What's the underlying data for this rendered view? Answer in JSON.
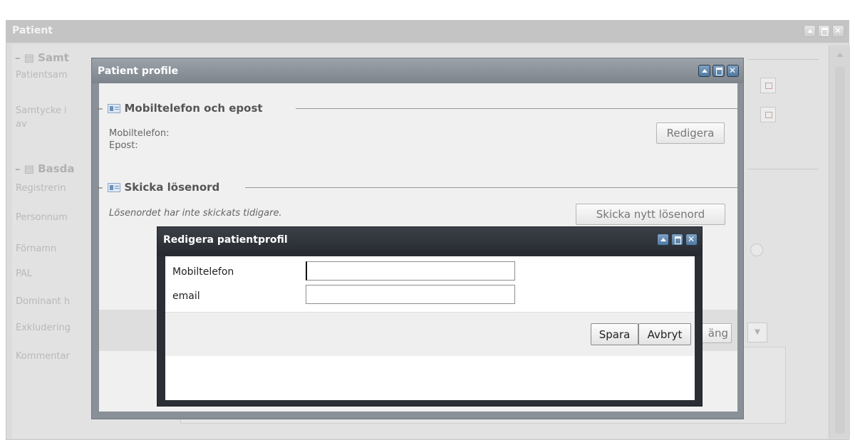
{
  "background_window": {
    "title": "Patient",
    "section1_legend": "Samt",
    "section2_legend": "Basda",
    "labels": [
      "Patientsam",
      "Samtycke i",
      "av",
      "Registrerin",
      "Personnum",
      "Förnamn",
      "PAL",
      "Dominant h",
      "Exkludering",
      "Kommentar"
    ]
  },
  "profile_window": {
    "title": "Patient profile",
    "section1": {
      "legend": "Mobiltelefon och epost",
      "mobile_label": "Mobiltelefon:",
      "email_label": "Epost:",
      "edit_button": "Redigera"
    },
    "section2": {
      "legend": "Skicka lösenord",
      "info": "Lösenordet har inte skickats tidigare.",
      "send_button": "Skicka nytt lösenord"
    },
    "footer_button_partial": "äng"
  },
  "edit_dialog": {
    "title": "Redigera patientprofil",
    "fields": {
      "mobile_label": "Mobiltelefon",
      "mobile_value": "",
      "email_label": "email",
      "email_value": ""
    },
    "save_button": "Spara",
    "cancel_button": "Avbryt"
  }
}
